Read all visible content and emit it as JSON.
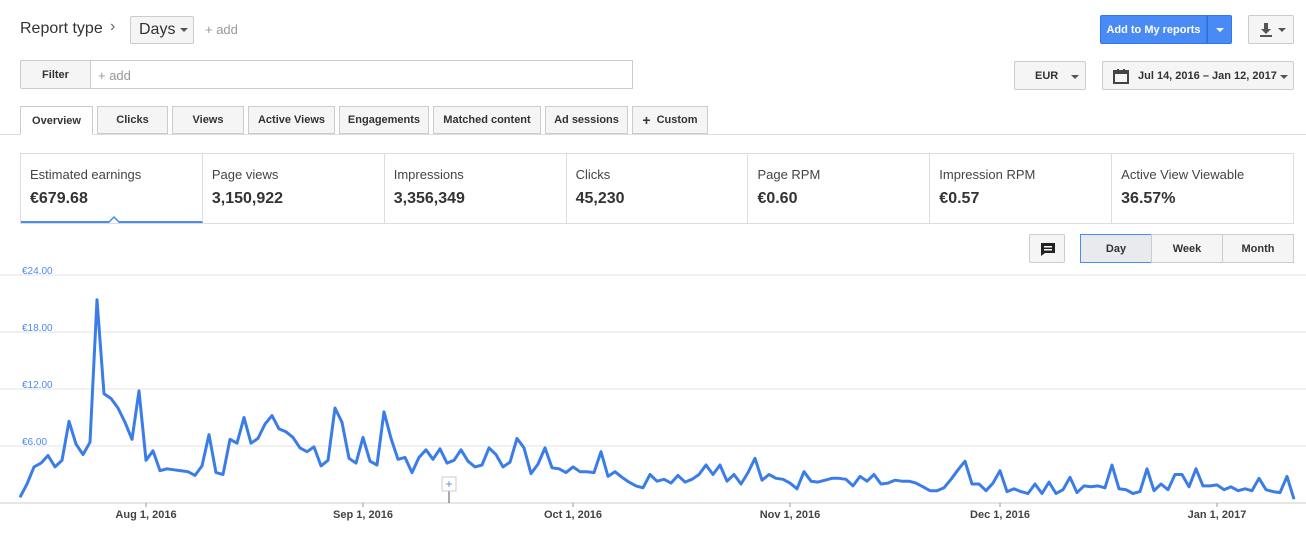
{
  "header": {
    "report_type_label": "Report type",
    "granularity_select": "Days",
    "add_label": "+ add",
    "add_to_reports_label": "Add to My reports"
  },
  "filter": {
    "button_label": "Filter",
    "input_placeholder": "+ add"
  },
  "currency": "EUR",
  "date_range": "Jul 14, 2016 – Jan 12, 2017",
  "tabs": [
    {
      "label": "Overview",
      "active": true
    },
    {
      "label": "Clicks"
    },
    {
      "label": "Views"
    },
    {
      "label": "Active Views"
    },
    {
      "label": "Engagements"
    },
    {
      "label": "Matched content"
    },
    {
      "label": "Ad sessions"
    },
    {
      "label": "Custom",
      "icon": "plus-icon"
    }
  ],
  "metrics": [
    {
      "label": "Estimated earnings",
      "value": "€679.68",
      "selected": true
    },
    {
      "label": "Page views",
      "value": "3,150,922"
    },
    {
      "label": "Impressions",
      "value": "3,356,349"
    },
    {
      "label": "Clicks",
      "value": "45,230"
    },
    {
      "label": "Page RPM",
      "value": "€0.60"
    },
    {
      "label": "Impression RPM",
      "value": "€0.57"
    },
    {
      "label": "Active View Viewable",
      "value": "36.57%"
    }
  ],
  "granularity_buttons": [
    "Day",
    "Week",
    "Month"
  ],
  "active_granularity": "Day",
  "colors": {
    "accent": "#4a8af4",
    "line": "#3b7de8"
  },
  "chart_data": {
    "type": "line",
    "x_start": "Jul 14, 2016",
    "x_end": "Jan 12, 2017",
    "x_ticks": [
      "Aug 1, 2016",
      "Sep 1, 2016",
      "Oct 1, 2016",
      "Nov 1, 2016",
      "Dec 1, 2016",
      "Jan 1, 2017"
    ],
    "y_ticks": [
      "€6.00",
      "€12.00",
      "€18.00",
      "€24.00"
    ],
    "ylim": [
      0,
      24
    ],
    "values": [
      0.6,
      2.0,
      3.8,
      4.2,
      5.0,
      3.8,
      4.5,
      8.6,
      6.2,
      5.1,
      6.4,
      21.4,
      11.5,
      11.0,
      10.0,
      8.5,
      6.7,
      11.8,
      4.5,
      5.5,
      3.4,
      3.6,
      3.5,
      3.4,
      3.3,
      2.9,
      3.9,
      7.2,
      3.2,
      3.0,
      6.7,
      6.3,
      9.0,
      6.3,
      6.8,
      8.3,
      9.2,
      7.8,
      7.5,
      6.9,
      5.8,
      5.4,
      5.9,
      3.9,
      4.5,
      10.0,
      8.5,
      4.7,
      4.2,
      6.9,
      4.4,
      4.0,
      9.6,
      6.8,
      4.6,
      4.8,
      3.2,
      4.8,
      5.6,
      4.6,
      5.7,
      4.2,
      4.5,
      5.6,
      4.4,
      3.8,
      4.0,
      5.8,
      5.1,
      3.8,
      4.3,
      6.8,
      5.8,
      3.1,
      4.1,
      5.8,
      3.7,
      3.6,
      3.2,
      3.8,
      3.3,
      3.3,
      3.2,
      5.4,
      2.8,
      3.3,
      2.7,
      2.2,
      1.8,
      1.6,
      3.0,
      2.3,
      2.5,
      2.1,
      2.9,
      2.2,
      2.5,
      3.0,
      4.0,
      3.0,
      4.0,
      2.3,
      3.0,
      2.0,
      3.2,
      4.7,
      2.4,
      3.0,
      2.6,
      2.5,
      2.1,
      1.5,
      3.3,
      2.3,
      2.2,
      2.4,
      2.6,
      2.6,
      2.5,
      1.8,
      2.8,
      2.3,
      3.0,
      2.0,
      2.1,
      2.4,
      2.3,
      2.3,
      2.1,
      1.7,
      1.3,
      1.3,
      1.6,
      2.5,
      3.5,
      4.4,
      2.0,
      2.0,
      1.3,
      2.1,
      3.4,
      1.2,
      1.5,
      1.2,
      1.0,
      2.0,
      1.0,
      2.2,
      1.0,
      1.4,
      2.7,
      1.1,
      1.8,
      1.7,
      1.8,
      1.6,
      4.0,
      1.5,
      1.4,
      1.0,
      1.2,
      3.6,
      1.3,
      2.0,
      1.4,
      3.0,
      3.0,
      1.7,
      3.6,
      1.8,
      1.8,
      1.9,
      1.4,
      1.7,
      1.3,
      1.5,
      1.3,
      2.6,
      1.4,
      1.2,
      1.1,
      2.8,
      0.4
    ]
  }
}
